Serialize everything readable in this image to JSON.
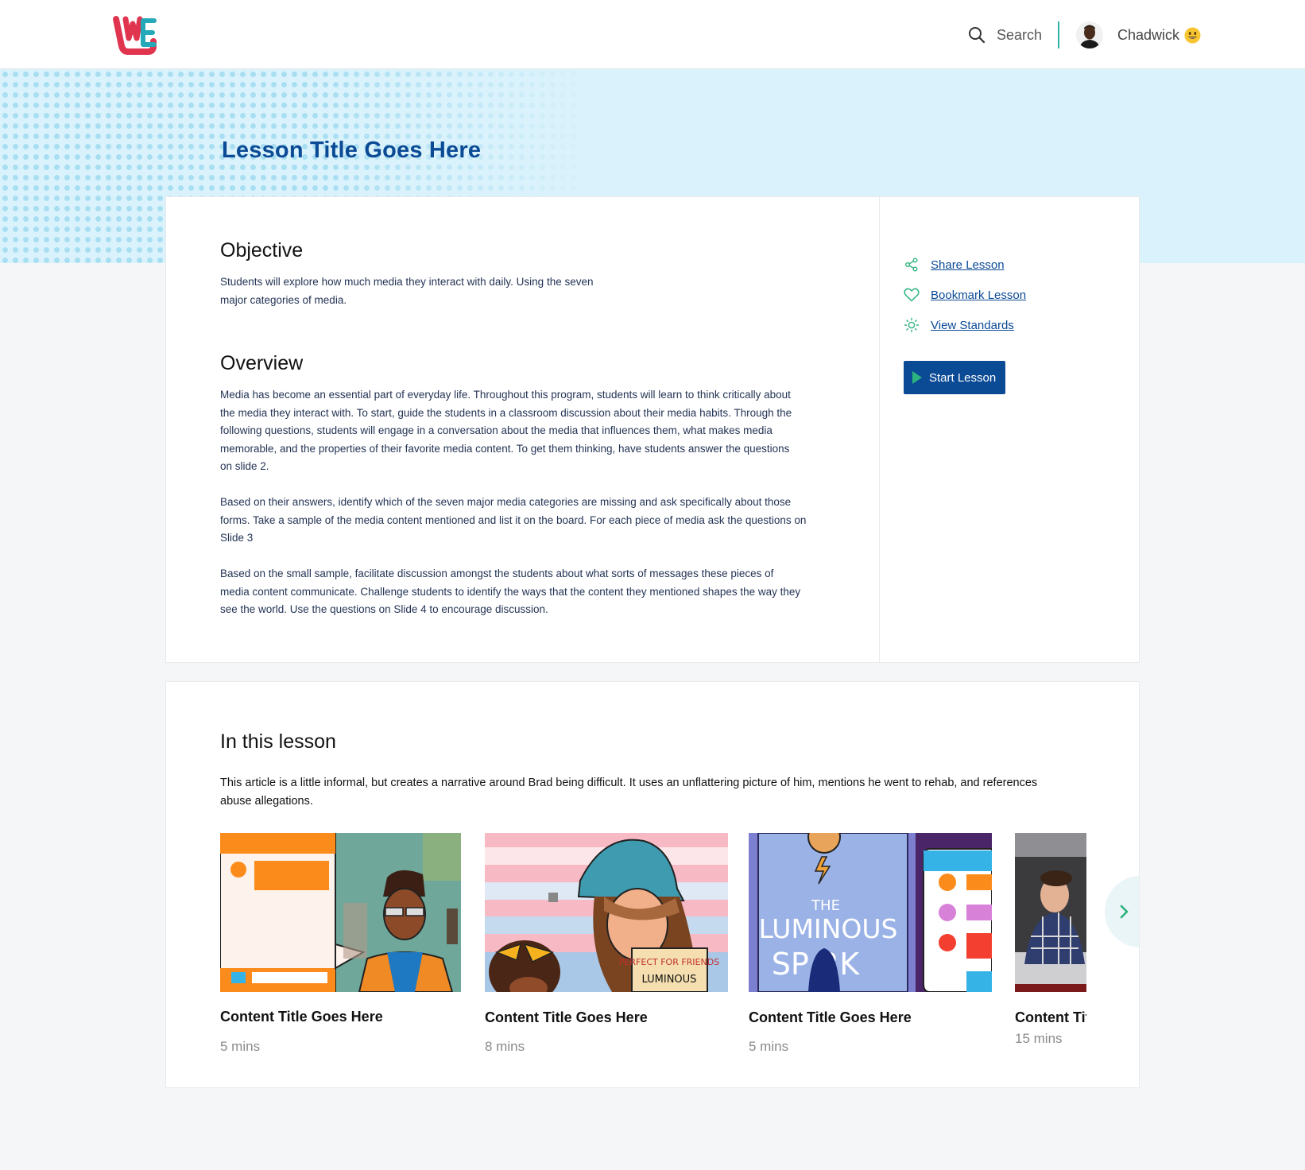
{
  "header": {
    "search_label": "Search",
    "user_name": "Chadwick",
    "accent_color": "#2db3a5"
  },
  "hero": {
    "title": "Lesson Title Goes Here",
    "title_color": "#0b4a95",
    "background_color": "#daf2fb"
  },
  "objective": {
    "heading": "Objective",
    "text_line1": "Students will explore how much media they interact with daily. Using the seven",
    "text_line2": "major categories of media."
  },
  "overview": {
    "heading": "Overview",
    "p1": [
      "Media has become an essential part of everyday life. Throughout this program, students will learn to think critically about",
      "the media they interact with. To start, guide the students in a classroom discussion about their media habits. Through the",
      "following questions, students will engage in a conversation about the media that influences them, what makes media",
      "memorable, and the properties of their favorite media content. To get them thinking, have students answer the questions",
      "on slide 2."
    ],
    "p2": [
      "Based on their answers, identify which of the seven major media categories are missing and ask specifically about those",
      "forms. Take a sample of the media content mentioned and list it on the board. For each piece of media ask the questions on",
      "Slide 3"
    ],
    "p3": [
      "Based on the small sample, facilitate discussion amongst the students about what sorts of messages these pieces of",
      "media content communicate. Challenge students to identify the ways that the content they mentioned shapes the way they",
      "see the world. Use the questions on Slide 4 to encourage discussion."
    ]
  },
  "actions": {
    "share": "Share Lesson",
    "bookmark": "Bookmark Lesson",
    "standards": "View Standards",
    "start": "Start Lesson",
    "icons": [
      "share-icon",
      "heart-icon",
      "sun-icon",
      "play-icon"
    ],
    "icon_color": "#2db37d",
    "primary_color": "#0b4a95"
  },
  "lesson": {
    "heading": "In this lesson",
    "description_line1": "This article is a little informal, but creates a narrative around Brad being difficult. It uses an unflattering picture of him, mentions he went to rehab, and references",
    "description_line2": "abuse allegations.",
    "items": [
      {
        "title": "Content Title Goes Here",
        "duration": "5 mins"
      },
      {
        "title": "Content Title Goes Here",
        "duration": "8 mins"
      },
      {
        "title": "Content Title Goes Here",
        "duration": "5 mins"
      },
      {
        "title": "Content Title Goes Here",
        "duration": "15 mins"
      }
    ],
    "thumb_text": {
      "card2_sign": "PERFECT FOR FRIENDS",
      "card2_sign_sub": "LUMINOUS",
      "card3_the": "THE",
      "card3_title": "LUMINOUS",
      "card3_title2": "SP   RK"
    }
  }
}
